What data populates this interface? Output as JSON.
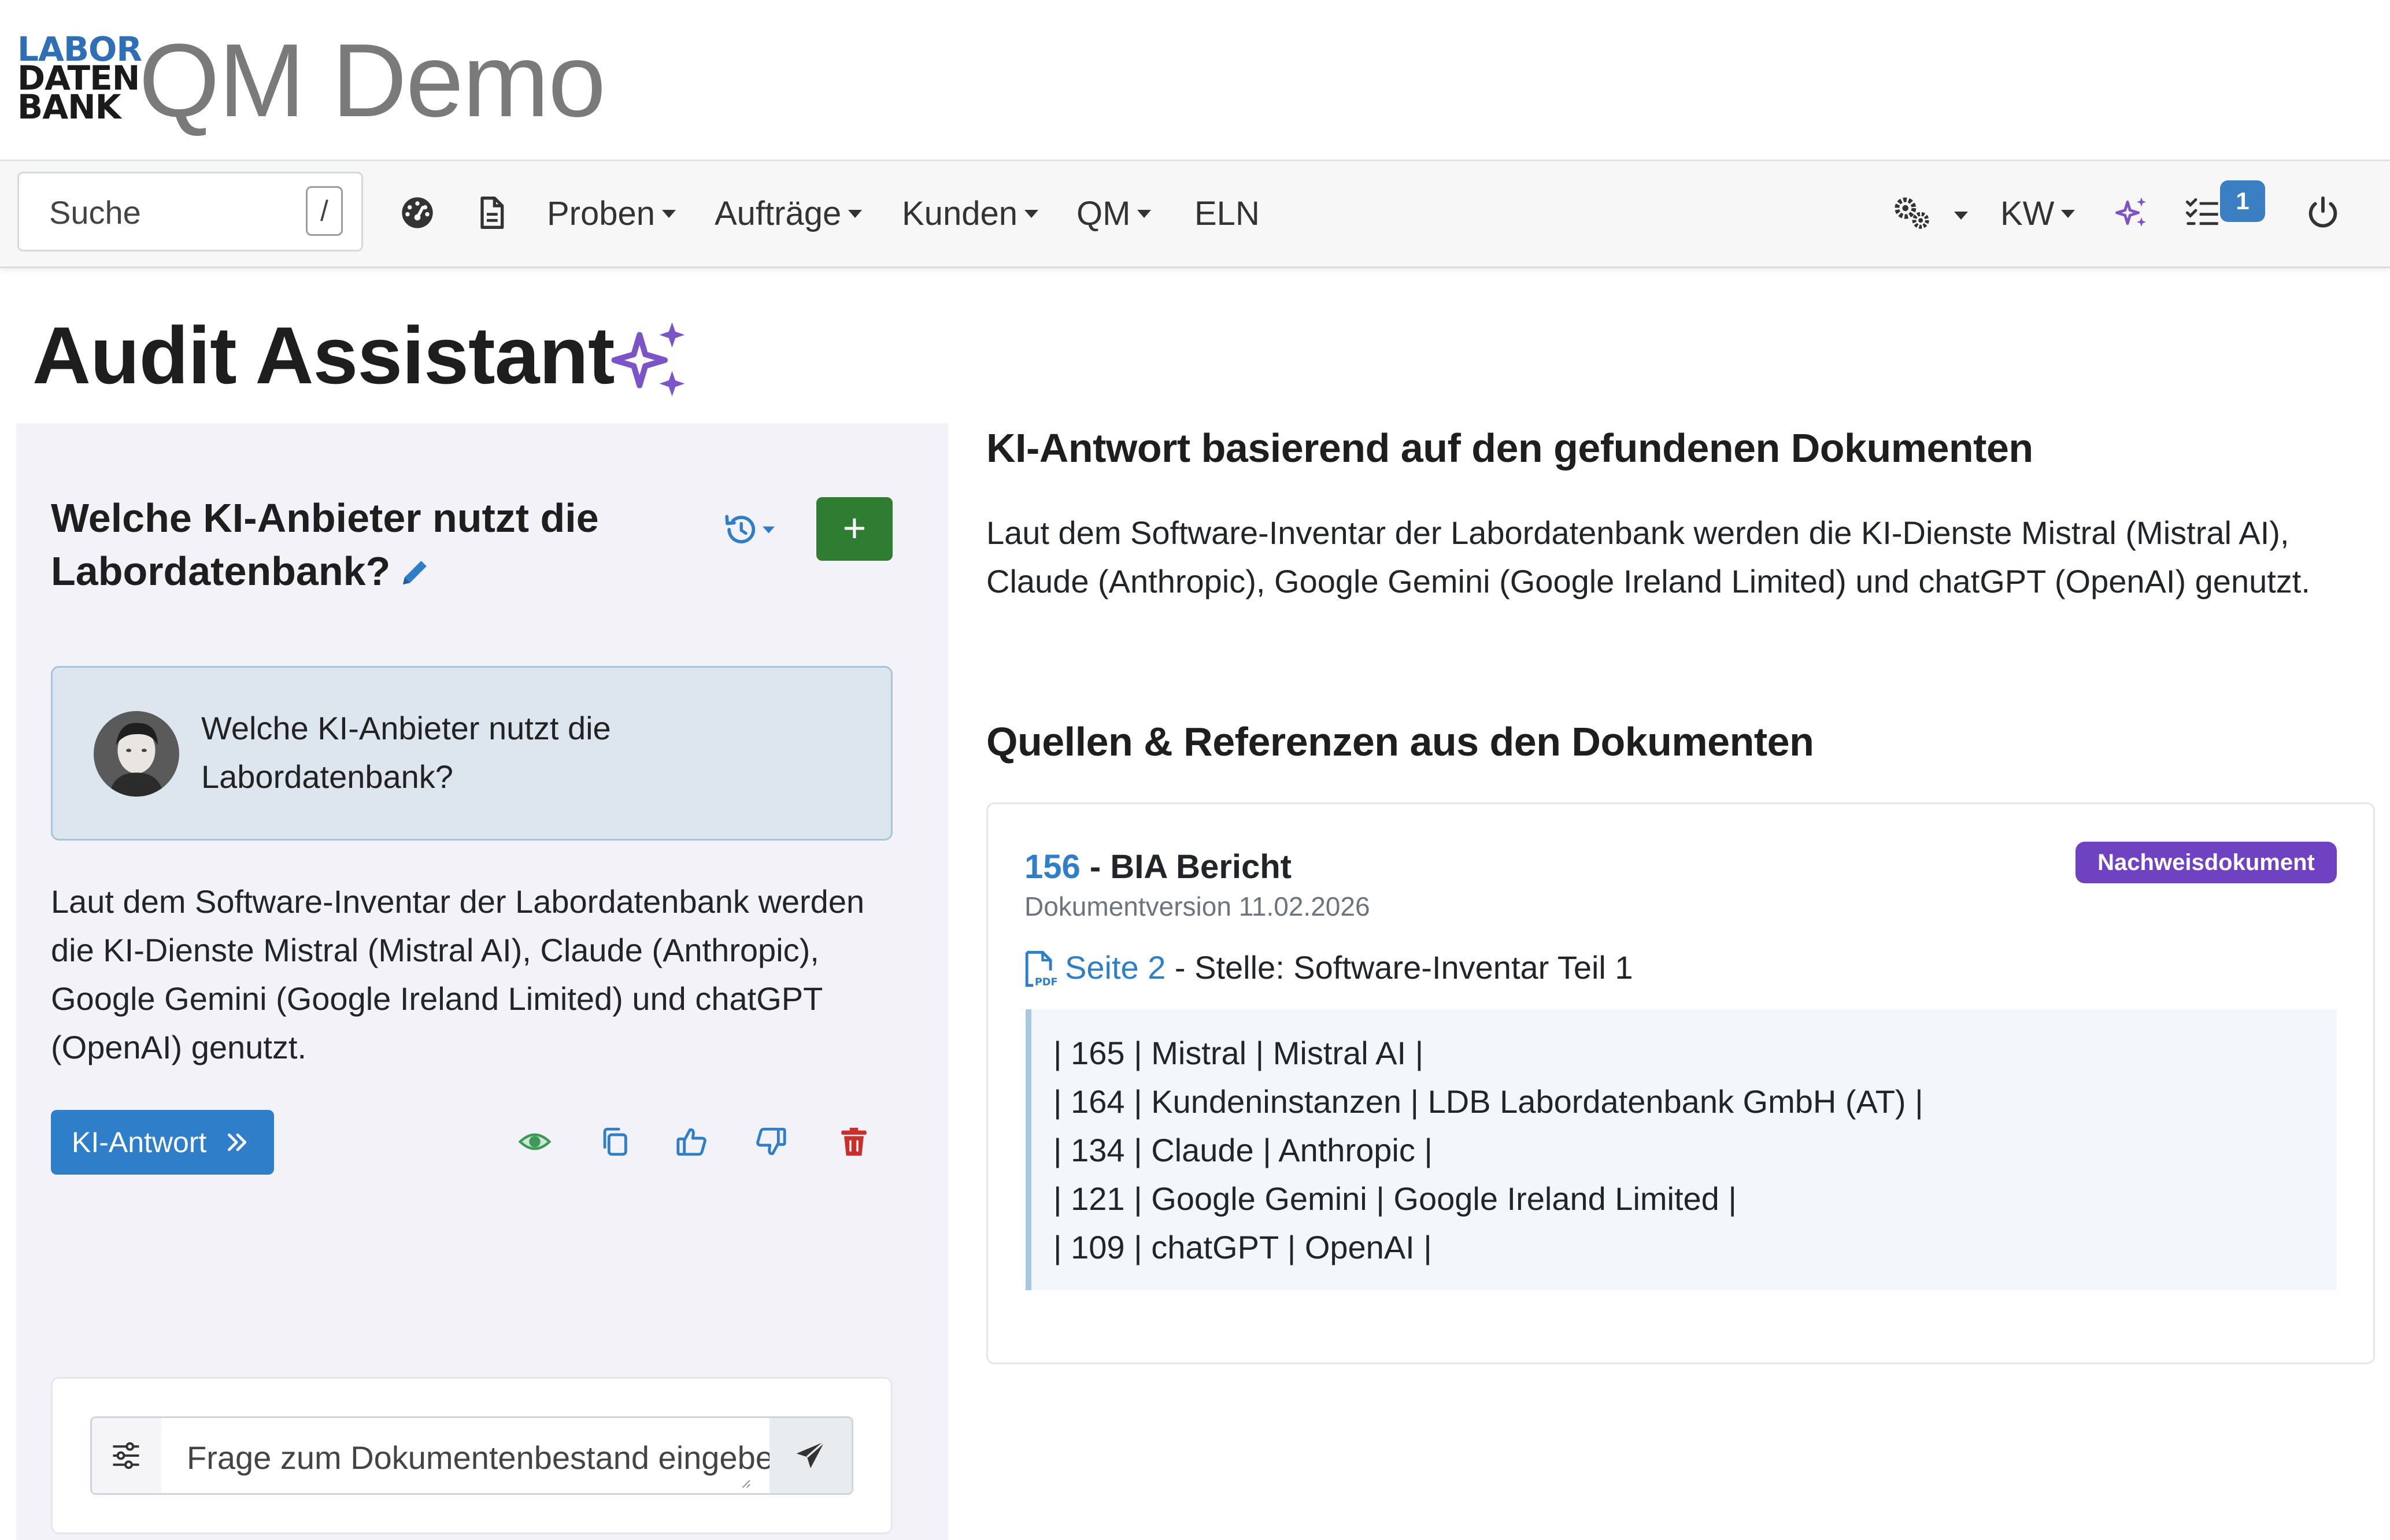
{
  "app": {
    "logo_lines": [
      "LABOR",
      "DATEN",
      "BANK"
    ],
    "title": "QM Demo"
  },
  "navbar": {
    "search_placeholder": "Suche",
    "search_shortcut": "/",
    "icons": [
      "dashboard-icon",
      "document-icon"
    ],
    "menus": [
      "Proben",
      "Aufträge",
      "Kunden",
      "QM"
    ],
    "eln": "ELN",
    "right": {
      "settings_icon": "gears-icon",
      "user_initials": "KW",
      "ai_icon": "sparkles-icon",
      "todo_icon": "checklist-icon",
      "todo_count": "1",
      "logout_icon": "power-icon"
    }
  },
  "page": {
    "title": "Audit Assistant"
  },
  "chat": {
    "question_title": "Welche KI-Anbieter nutzt die Labordatenbank?",
    "new_chat_label": "+",
    "user_message": "Welche KI-Anbieter nutzt die Labordatenbank?",
    "assistant_answer": "Laut dem Software-Inventar der Labordatenbank werden die KI-Dienste Mistral (Mistral AI), Claude (Anthropic), Google Gemini (Google Ireland Limited) und chatGPT (OpenAI) genutzt.",
    "ki_button_label": "KI-Antwort",
    "action_icons": [
      "eye-icon",
      "copy-icon",
      "thumbs-up-icon",
      "thumbs-down-icon",
      "trash-icon"
    ],
    "input_placeholder": "Frage zum Dokumentenbestand eingeben"
  },
  "answer_panel": {
    "heading": "KI-Antwort basierend auf den gefundenen Dokumenten",
    "text": "Laut dem Software-Inventar der Labordatenbank werden die KI-Dienste Mistral (Mistral AI), Claude (Anthropic), Google Gemini (Google Ireland Limited) und chatGPT (OpenAI) genutzt."
  },
  "sources": {
    "heading": "Quellen & Referenzen aus den Dokumenten",
    "items": [
      {
        "doc_id": "156",
        "title_rest": " - BIA Bericht",
        "badge": "Nachweisdokument",
        "version": "Dokumentversion 11.02.2026",
        "page_link": "Seite 2",
        "location": " - Stelle: Software-Inventar Teil 1",
        "excerpt": [
          "| 165 | Mistral | Mistral AI |",
          "| 164 | Kundeninstanzen | LDB Labordatenbank GmbH (AT) |",
          "| 134 | Claude | Anthropic |",
          "| 121 | Google Gemini | Google Ireland Limited |",
          "| 109 | chatGPT | OpenAI |"
        ]
      }
    ]
  },
  "colors": {
    "primary": "#2f7ec9",
    "success": "#2e7d32",
    "badge": "#6f42c1",
    "sparkle": "#7b55c7",
    "danger": "#c9302c",
    "eye": "#3c9a57"
  }
}
